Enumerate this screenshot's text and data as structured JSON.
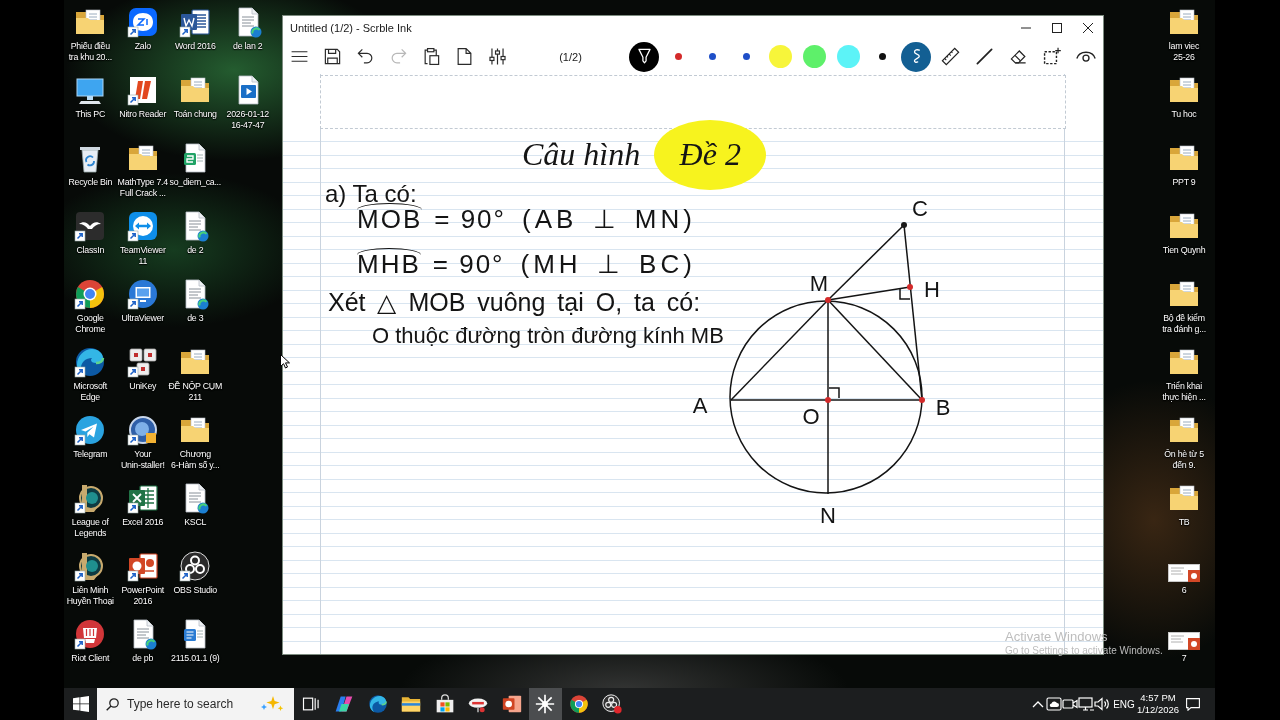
{
  "desktop": {
    "columns": [
      {
        "icons": [
          {
            "label": "Phiếu điều\ntra khu 20...",
            "kind": "folder",
            "shortcut": false
          },
          {
            "label": "This PC",
            "kind": "pc",
            "shortcut": false
          },
          {
            "label": "Recycle Bin",
            "kind": "recycle",
            "shortcut": false
          },
          {
            "label": "ClassIn",
            "kind": "classin",
            "shortcut": true
          },
          {
            "label": "Google\nChrome",
            "kind": "chrome",
            "shortcut": true
          },
          {
            "label": "Microsoft\nEdge",
            "kind": "edge",
            "shortcut": true
          },
          {
            "label": "Telegram",
            "kind": "telegram",
            "shortcut": true
          },
          {
            "label": "League of\nLegends",
            "kind": "lol",
            "shortcut": true
          },
          {
            "label": "Liên Minh\nHuyền Thoại",
            "kind": "lol",
            "shortcut": true
          },
          {
            "label": "Riot Client",
            "kind": "riot",
            "shortcut": true
          }
        ]
      },
      {
        "icons": [
          {
            "label": "Zalo",
            "kind": "zalo",
            "shortcut": true
          },
          {
            "label": "Nitro Reader",
            "kind": "nitro",
            "shortcut": true
          },
          {
            "label": "MathType 7.4\nFull Crack ...",
            "kind": "folder",
            "shortcut": false
          },
          {
            "label": "TeamViewer\n11",
            "kind": "teamviewer",
            "shortcut": true
          },
          {
            "label": "UltraViewer",
            "kind": "ultraviewer",
            "shortcut": true
          },
          {
            "label": "UniKey",
            "kind": "unikey",
            "shortcut": true
          },
          {
            "label": "Your\nUnin-staller!",
            "kind": "uninstaller",
            "shortcut": true
          },
          {
            "label": "Excel 2016",
            "kind": "excel",
            "shortcut": true
          },
          {
            "label": "PowerPoint\n2016",
            "kind": "powerpoint",
            "shortcut": true
          },
          {
            "label": "de pb",
            "kind": "document",
            "shortcut": false
          }
        ]
      },
      {
        "icons": [
          {
            "label": "Word 2016",
            "kind": "word",
            "shortcut": true
          },
          {
            "label": "Toán chung",
            "kind": "folder",
            "shortcut": false
          },
          {
            "label": "so_diem_ca...",
            "kind": "sheet",
            "shortcut": false
          },
          {
            "label": "de 2",
            "kind": "document",
            "shortcut": false
          },
          {
            "label": "de 3",
            "kind": "document",
            "shortcut": false
          },
          {
            "label": "ĐỀ NỘP CỤM\n211",
            "kind": "folder",
            "shortcut": false
          },
          {
            "label": "Chương\n6-Hàm số y...",
            "kind": "folder",
            "shortcut": false
          },
          {
            "label": "KSCL",
            "kind": "document",
            "shortcut": false
          },
          {
            "label": "OBS Studio",
            "kind": "obs",
            "shortcut": true
          },
          {
            "label": "2115.01.1 (9)",
            "kind": "word-doc",
            "shortcut": false
          }
        ]
      },
      {
        "icons": [
          {
            "label": "de lan 2",
            "kind": "document",
            "shortcut": false
          },
          {
            "label": "2026-01-12\n16-47-47",
            "kind": "video",
            "shortcut": false
          }
        ]
      }
    ],
    "right_column": {
      "icons": [
        {
          "label": "lam viec\n25-26",
          "kind": "folder",
          "shortcut": false
        },
        {
          "label": "Tu hoc",
          "kind": "folder",
          "shortcut": false
        },
        {
          "label": "PPT 9",
          "kind": "folder",
          "shortcut": false
        },
        {
          "label": "Tien Quynh",
          "kind": "folder",
          "shortcut": false
        },
        {
          "label": "Bộ đề kiểm\ntra đánh g...",
          "kind": "folder",
          "shortcut": false
        },
        {
          "label": "Triển khai\nthực hiện ...",
          "kind": "folder",
          "shortcut": false
        },
        {
          "label": "Ôn hè từ 5\nđến 9.",
          "kind": "folder",
          "shortcut": false
        },
        {
          "label": "TB",
          "kind": "folder",
          "shortcut": false
        },
        {
          "label": "6",
          "kind": "slide",
          "shortcut": false
        },
        {
          "label": "7",
          "kind": "slide",
          "shortcut": false
        }
      ]
    }
  },
  "window": {
    "title": "Untitled (1/2) - Scrble Ink",
    "controls": [
      {
        "kind": "minimize"
      },
      {
        "kind": "maximize"
      },
      {
        "kind": "close"
      }
    ],
    "toolbar": {
      "actions": [
        {
          "kind": "menu",
          "disabled": false
        },
        {
          "kind": "save",
          "disabled": false
        },
        {
          "kind": "undo",
          "disabled": false
        },
        {
          "kind": "redo",
          "disabled": true
        },
        {
          "kind": "paste",
          "disabled": false
        },
        {
          "kind": "new-page",
          "disabled": false
        },
        {
          "kind": "adjust",
          "disabled": false
        }
      ],
      "page": "(1/2)",
      "tools": [
        {
          "kind": "pen",
          "active": true
        },
        {
          "kind": "pen-color",
          "color": "#d42a2a",
          "active": false
        },
        {
          "kind": "pen-color",
          "color": "#1f4fc8",
          "active": false
        },
        {
          "kind": "pen-color",
          "color": "#1f4fc8",
          "active": false
        },
        {
          "kind": "highlighter-color",
          "color": "#f7f53a",
          "active": false
        },
        {
          "kind": "highlighter-color",
          "color": "#5ef06a",
          "active": false
        },
        {
          "kind": "highlighter-color",
          "color": "#5cf3f7",
          "active": false
        },
        {
          "kind": "pen-color",
          "color": "#111111",
          "active": false
        },
        {
          "kind": "smooth",
          "active": true
        },
        {
          "kind": "ruler",
          "active": false
        },
        {
          "kind": "line",
          "active": false
        },
        {
          "kind": "eraser",
          "active": false
        },
        {
          "kind": "select",
          "active": false
        },
        {
          "kind": "view",
          "active": false
        }
      ]
    },
    "canvas": {
      "heading": [
        {
          "text": "Câu hình",
          "highlighted": false
        },
        {
          "text": "Đề 2",
          "highlighted": true
        }
      ],
      "lines": [
        {
          "kind": "text",
          "text": "a) Ta có:"
        },
        {
          "kind": "angle",
          "angle": "MOB",
          "value": "= 90°",
          "reason": "(AB ⊥ MN)"
        },
        {
          "kind": "angle",
          "angle": "MHB",
          "value": "= 90°",
          "reason": "(MH ⊥ BC)"
        },
        {
          "kind": "text",
          "text": "Xét △ MOB vuông tại O, ta có:"
        },
        {
          "kind": "text",
          "text": "O thuộc đường tròn đường kính MB"
        }
      ],
      "figure": {
        "points": [
          {
            "label": "C",
            "marked": true,
            "color": "#1a1a1a"
          },
          {
            "label": "M",
            "marked": true,
            "color": "#d42a2a"
          },
          {
            "label": "H",
            "marked": true,
            "color": "#d42a2a"
          },
          {
            "label": "A",
            "marked": false
          },
          {
            "label": "O",
            "marked": true,
            "color": "#d42a2a"
          },
          {
            "label": "B",
            "marked": true,
            "color": "#d42a2a"
          },
          {
            "label": "N",
            "marked": false
          }
        ]
      }
    }
  },
  "watermark": {
    "title": "Activate Windows",
    "subtitle": "Go to Settings to activate Windows."
  },
  "taskbar": {
    "search": {
      "placeholder": "Type here to search"
    },
    "apps": [
      {
        "kind": "task-view",
        "selected": false
      },
      {
        "kind": "copilot",
        "selected": false
      },
      {
        "kind": "edge",
        "selected": false
      },
      {
        "kind": "explorer",
        "selected": false
      },
      {
        "kind": "store",
        "selected": false
      },
      {
        "kind": "app",
        "selected": false
      },
      {
        "kind": "powerpoint",
        "selected": false
      },
      {
        "kind": "ink",
        "selected": true
      },
      {
        "kind": "chrome",
        "selected": false
      },
      {
        "kind": "obs",
        "selected": false
      }
    ],
    "tray": {
      "icons": [
        {
          "kind": "chevron"
        },
        {
          "kind": "cloud"
        },
        {
          "kind": "camera"
        },
        {
          "kind": "network"
        },
        {
          "kind": "volume"
        }
      ],
      "language": "ENG",
      "time": "4:57 PM",
      "date": "1/12/2026"
    }
  }
}
